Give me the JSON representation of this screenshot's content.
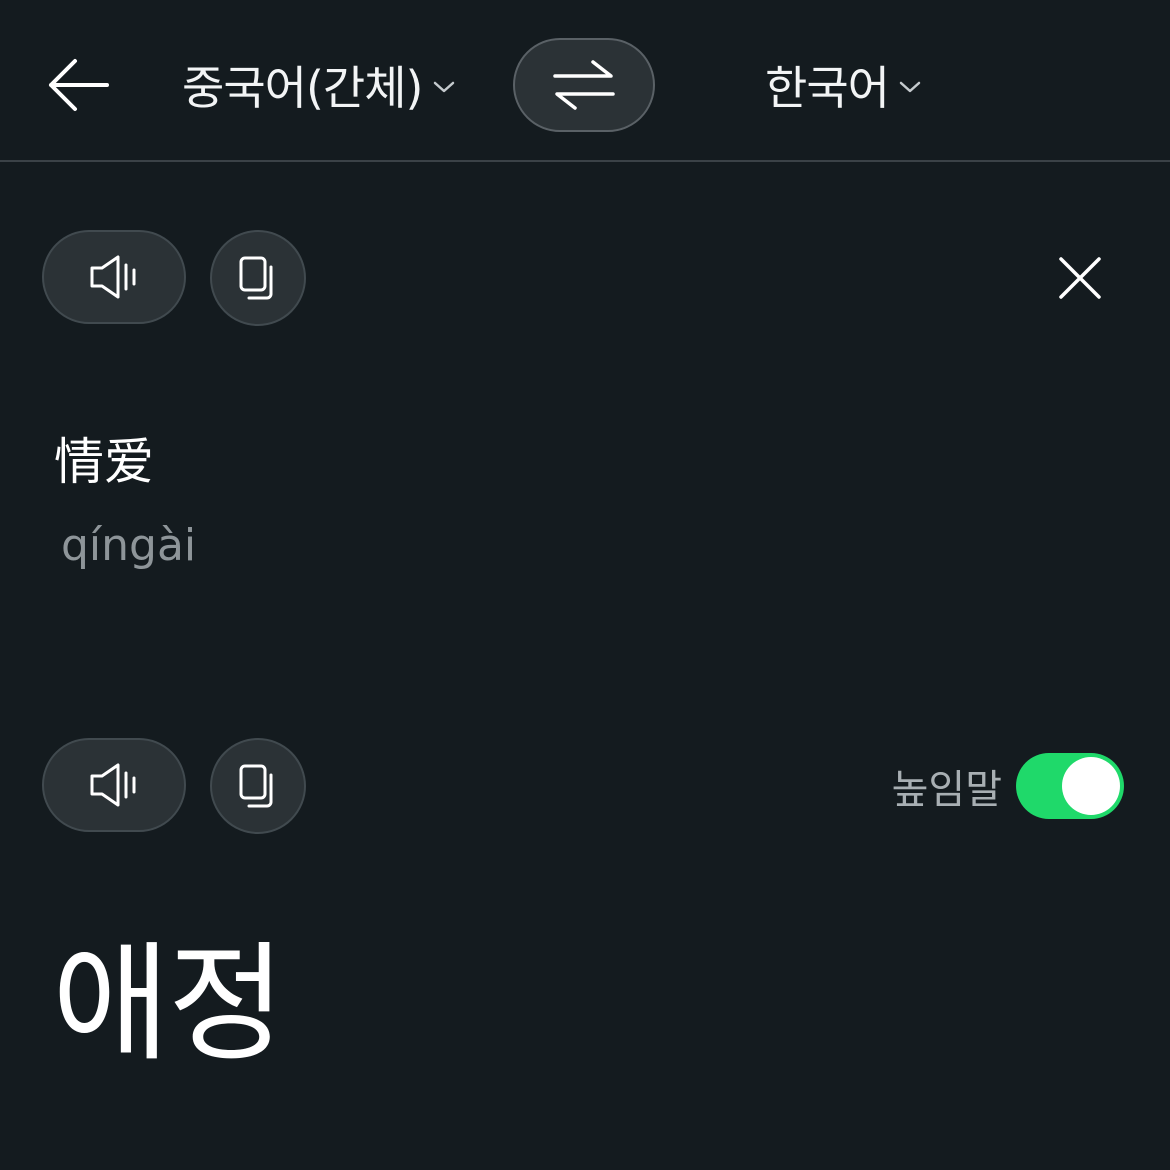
{
  "header": {
    "back_icon": "arrow-left-icon",
    "source_language": "중국어(간체)",
    "target_language": "한국어",
    "swap_icon": "swap-arrows-icon",
    "chevron_icon": "chevron-down-icon"
  },
  "source": {
    "speak_icon": "speaker-icon",
    "copy_icon": "copy-icon",
    "close_icon": "close-icon",
    "text": "情爱",
    "pinyin": "qíngài"
  },
  "result": {
    "speak_icon": "speaker-icon",
    "copy_icon": "copy-icon",
    "honorific_label": "높임말",
    "honorific_enabled": true,
    "text": "애정"
  },
  "colors": {
    "background": "#141b1f",
    "button_bg": "#2b3236",
    "toggle_on": "#1fd96a",
    "muted_text": "#8e9599"
  }
}
